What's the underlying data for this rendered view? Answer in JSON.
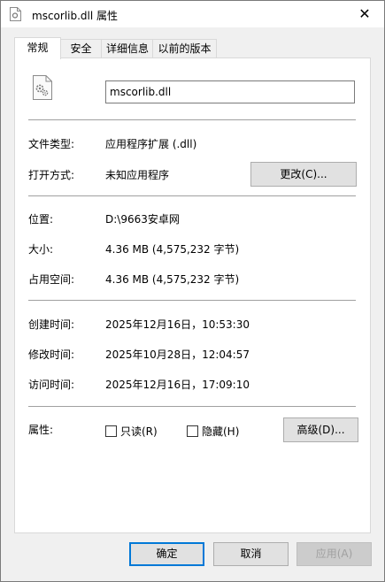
{
  "window": {
    "title": "mscorlib.dll 属性",
    "close_glyph": "✕"
  },
  "tabs": [
    {
      "label": "常规",
      "active": true
    },
    {
      "label": "安全",
      "active": false
    },
    {
      "label": "详细信息",
      "active": false
    },
    {
      "label": "以前的版本",
      "active": false
    }
  ],
  "general": {
    "file_name": "mscorlib.dll",
    "type_label": "文件类型:",
    "type_value": "应用程序扩展 (.dll)",
    "open_with_label": "打开方式:",
    "open_with_value": "未知应用程序",
    "change_button": "更改(C)...",
    "location_label": "位置:",
    "location_value": "D:\\9663安卓网",
    "size_label": "大小:",
    "size_value": "4.36 MB (4,575,232 字节)",
    "size_on_disk_label": "占用空间:",
    "size_on_disk_value": "4.36 MB (4,575,232 字节)",
    "created_label": "创建时间:",
    "created_value": "2025年12月16日，10:53:30",
    "modified_label": "修改时间:",
    "modified_value": "2025年10月28日，12:04:57",
    "accessed_label": "访问时间:",
    "accessed_value": "2025年12月16日，17:09:10",
    "attributes_label": "属性:",
    "readonly_label": "只读(R)",
    "readonly_checked": false,
    "hidden_label": "隐藏(H)",
    "hidden_checked": false,
    "advanced_button": "高级(D)..."
  },
  "footer": {
    "ok": "确定",
    "cancel": "取消",
    "apply": "应用(A)"
  },
  "colors": {
    "accent": "#0078d7",
    "panel_bg": "#ffffff",
    "window_bg": "#f0f0f0"
  }
}
